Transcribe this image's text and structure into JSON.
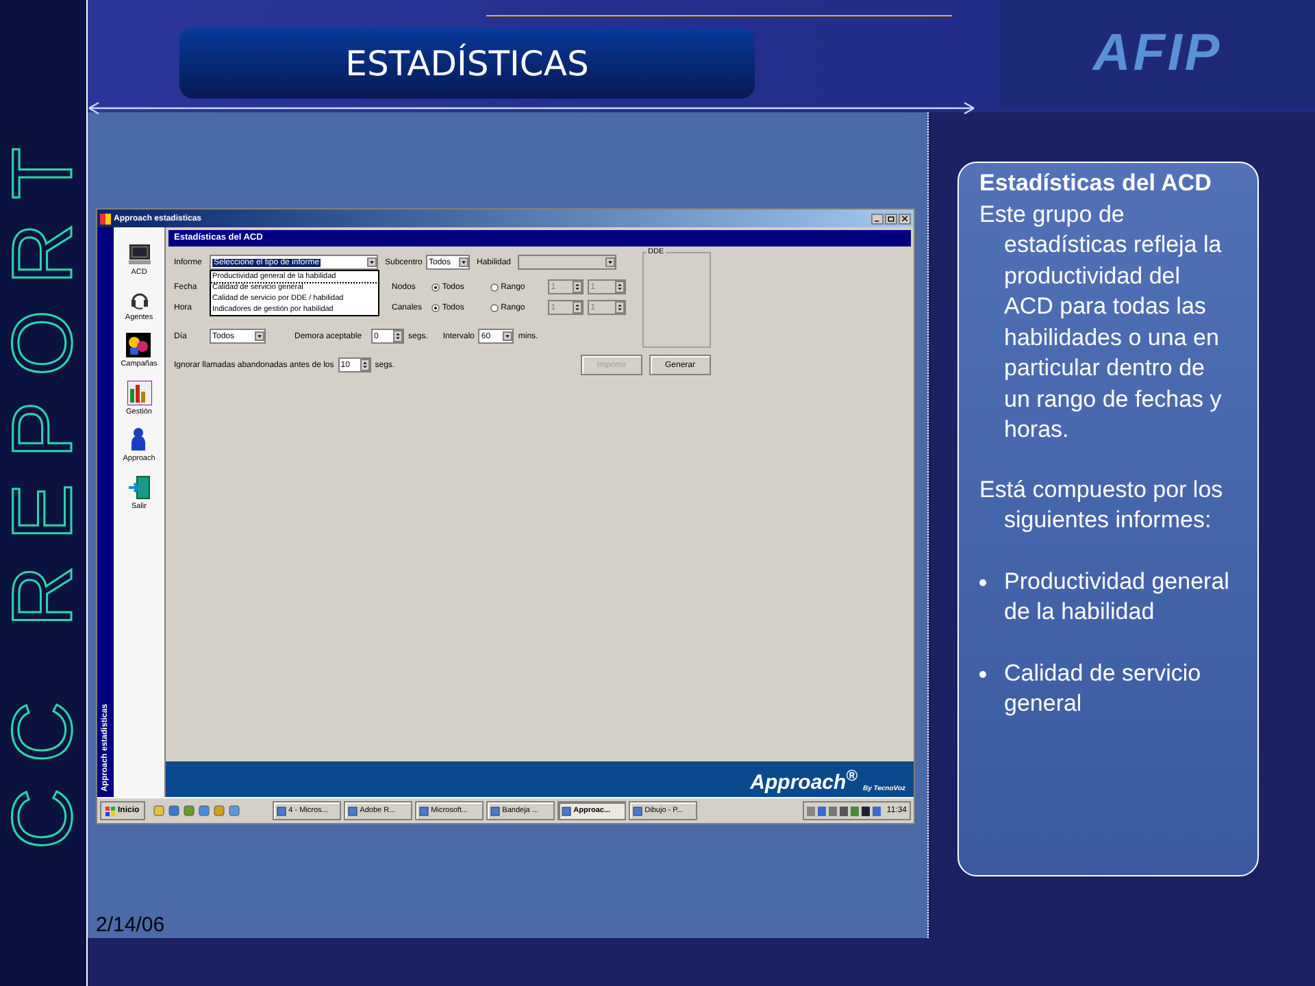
{
  "slide": {
    "title": "ESTADÍSTICAS",
    "logo": "AFIP",
    "side_text": "CC REPORT",
    "date": "2/14/06"
  },
  "app": {
    "title": "Approach estadisticas",
    "sidebar_caption": "Approach estadisticas",
    "nav": [
      {
        "label": "ACD"
      },
      {
        "label": "Agentes"
      },
      {
        "label": "Campañas"
      },
      {
        "label": "Gestión"
      },
      {
        "label": "Approach"
      },
      {
        "label": "Salir"
      }
    ],
    "panel_title": "Estadísticas del ACD",
    "informe": {
      "label": "Informe",
      "value": "Seleccione el tipo de informe",
      "options": [
        {
          "label": "Productividad general de la habilidad",
          "selected": true
        },
        {
          "label": "Calidad de servicio general",
          "selected": false
        },
        {
          "label": "Calidad de servicio por DDE / habilidad",
          "selected": false
        },
        {
          "label": "Indicadores de gestión por habilidad",
          "selected": false
        }
      ]
    },
    "subcentro": {
      "label": "Subcentro",
      "value": "Todos"
    },
    "habilidad": {
      "label": "Habilidad",
      "disabled": true
    },
    "fecha_label": "Fecha",
    "hora_label": "Hora",
    "ranges": [
      {
        "label": "Nodos",
        "disabled": true,
        "from": "1",
        "to": "1",
        "options": [
          {
            "label": "Todos",
            "selected": true
          },
          {
            "label": "Rango",
            "selected": false
          }
        ]
      },
      {
        "label": "Canales",
        "disabled": true,
        "from": "1",
        "to": "1",
        "options": [
          {
            "label": "Todos",
            "selected": true
          },
          {
            "label": "Rango",
            "selected": false
          }
        ]
      }
    ],
    "dia": {
      "label": "Día",
      "value": "Todos"
    },
    "demora": {
      "label": "Demora aceptable",
      "value": "0",
      "unit": "segs."
    },
    "intervalo": {
      "label": "Intervalo",
      "value": "60",
      "unit": "mins."
    },
    "ignorar": {
      "label": "Ignorar llamadas abandonadas antes de los",
      "value": "10",
      "unit": "segs."
    },
    "dde_label": "DDE",
    "buttons": [
      {
        "label": "Imprimir",
        "disabled": true
      },
      {
        "label": "Generar",
        "disabled": false
      }
    ],
    "brand": "Approach$^{®}$",
    "brand_tagline": "By TecnoVoz",
    "taskbar": {
      "start": "Inicio",
      "tasks": [
        {
          "label": "4 - Micros...",
          "selected": false
        },
        {
          "label": "Adobe R...",
          "selected": false
        },
        {
          "label": "Microsoft...",
          "selected": false
        },
        {
          "label": "Bandeja ...",
          "selected": false
        },
        {
          "label": "Approac...",
          "selected": true
        },
        {
          "label": "Dibujo - P...",
          "selected": false
        }
      ],
      "clock": "11:34"
    }
  },
  "info": {
    "title": "Estadísticas del ACD",
    "paragraphs": [
      "Este grupo de estadísticas refleja la productividad del ACD para todas las habilidades o una en particular dentro de un rango de fechas y horas.",
      "Está compuesto por los siguientes informes:"
    ],
    "bullets": [
      "Productividad general de la habilidad",
      "Calidad de servicio general"
    ]
  }
}
